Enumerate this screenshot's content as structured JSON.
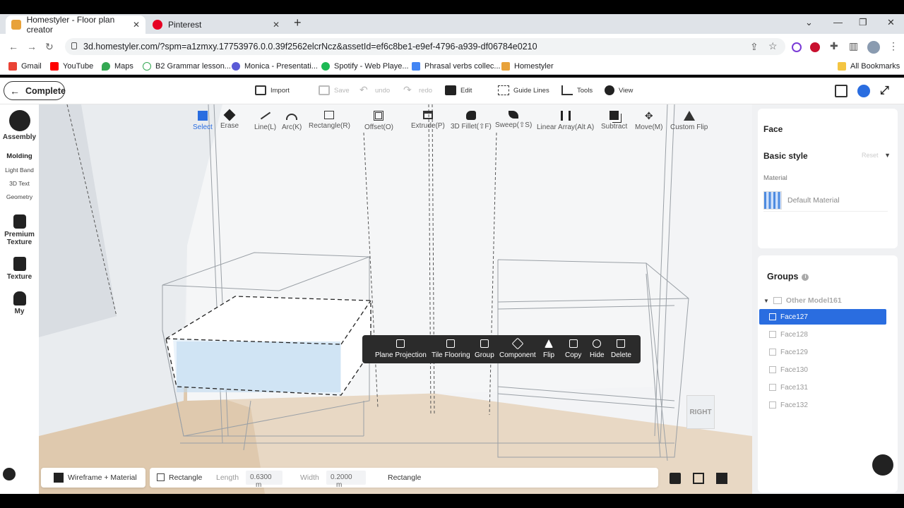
{
  "browser": {
    "tabs": [
      {
        "title": "Homestyler - Floor plan creator",
        "active": true
      },
      {
        "title": "Pinterest",
        "active": false
      }
    ],
    "url": "3d.homestyler.com/?spm=a1zmxy.17753976.0.0.39f2562elcrNcz&assetId=ef6c8be1-e9ef-4796-a939-df06784e0210",
    "bookmarks": [
      "Gmail",
      "YouTube",
      "Maps",
      "B2 Grammar lesson...",
      "Monica - Presentati...",
      "Spotify - Web Playe...",
      "Phrasal verbs collec...",
      "Homestyler"
    ],
    "all_bookmarks": "All Bookmarks"
  },
  "header": {
    "complete_label": "Complete",
    "tools": [
      "Import",
      "Save",
      "undo",
      "redo",
      "Edit",
      "Guide Lines",
      "Tools",
      "View"
    ]
  },
  "leftbar": {
    "assembly": "Assembly",
    "molding": "Molding",
    "light_band": "Light Band",
    "text_3d": "3D Text",
    "geometry": "Geometry",
    "premium_texture": "Premium Texture",
    "texture": "Texture",
    "my": "My"
  },
  "float_toolbar": [
    "Select",
    "Erase",
    "Line(L)",
    "Arc(K)",
    "Rectangle(R)",
    "Offset(O)",
    "Extrude(P)",
    "3D Fillet(⇧F)",
    "Sweep(⇧S)",
    "Linear Array(Alt A)",
    "Subtract",
    "Move(M)",
    "Custom Flip"
  ],
  "context_menu": [
    "Plane Projection",
    "Tile Flooring",
    "Group",
    "Component",
    "Flip",
    "Copy",
    "Hide",
    "Delete"
  ],
  "view_cube_label": "RIGHT",
  "status": {
    "render_mode": "Wireframe + Material",
    "tool": "Rectangle",
    "length_label": "Length",
    "length_value": "0.6300",
    "length_unit": "m",
    "width_label": "Width",
    "width_value": "0.2000",
    "width_unit": "m",
    "shape": "Rectangle"
  },
  "right_panel": {
    "face_title": "Face",
    "basic_style": "Basic style",
    "reset": "Reset",
    "material_label": "Material",
    "material_value": "Default Material",
    "groups_title": "Groups",
    "info_icon": "i",
    "tree_parent": "Other Model161",
    "faces": [
      "Face127",
      "Face128",
      "Face129",
      "Face130",
      "Face131",
      "Face132"
    ],
    "selected_face": "Face127"
  }
}
